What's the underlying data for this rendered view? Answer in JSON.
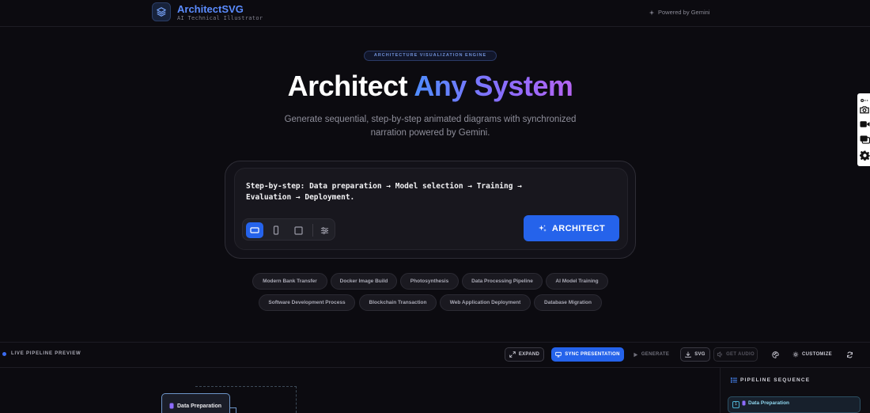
{
  "header": {
    "brand_name": "ArchitectSVG",
    "brand_subtitle": "AI Technical Illustrator",
    "powered_by": "Powered by Gemini"
  },
  "hero": {
    "badge": "ARCHITECTURE VISUALIZATION ENGINE",
    "title_plain": "Architect ",
    "title_gradient": "Any System",
    "subtitle_line1": "Generate sequential, step-by-step animated diagrams with synchronized",
    "subtitle_line2": "narration powered by Gemini."
  },
  "prompt": {
    "text": "Step-by-step: Data preparation → Model selection → Training → Evaluation → Deployment.",
    "architect_label": "ARCHITECT"
  },
  "chips": {
    "row1": [
      "Modern Bank Transfer",
      "Docker Image Build",
      "Photosynthesis",
      "Data Processing Pipeline",
      "AI Model Training"
    ],
    "row2": [
      "Software Development Process",
      "Blockchain Transaction",
      "Web Application Deployment",
      "Database Migration"
    ]
  },
  "panel": {
    "live_label": "LIVE PIPELINE PREVIEW",
    "expand": "EXPAND",
    "sync": "SYNC PRESENTATION",
    "generate": "GENERATE",
    "svg": "SVG",
    "get_audio": "GET AUDIO",
    "customize": "CUSTOMIZE"
  },
  "sequence": {
    "title": "PIPELINE SEQUENCE",
    "items": [
      {
        "num": "1",
        "label": "Data Preparation"
      }
    ]
  },
  "canvas": {
    "node_label": "Data Preparation"
  },
  "colors": {
    "accent": "#2563eb",
    "brand": "#5b8cff",
    "gradient_start": "#4f8dff",
    "gradient_end": "#b565f2",
    "background": "#0c0b10"
  }
}
